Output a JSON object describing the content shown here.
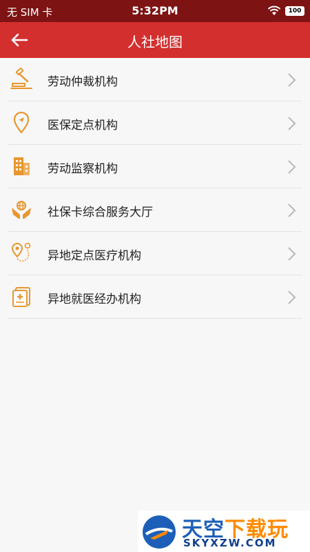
{
  "status_bar": {
    "carrier": "无 SIM 卡",
    "time": "5:32PM",
    "battery": "100"
  },
  "header": {
    "title": "人社地图"
  },
  "items": [
    {
      "label": "劳动仲裁机构",
      "icon": "gavel-icon"
    },
    {
      "label": "医保定点机构",
      "icon": "location-pin-icon"
    },
    {
      "label": "劳动监察机构",
      "icon": "building-icon"
    },
    {
      "label": "社保卡综合服务大厅",
      "icon": "hands-globe-icon"
    },
    {
      "label": "异地定点医疗机构",
      "icon": "route-pin-icon"
    },
    {
      "label": "异地就医经办机构",
      "icon": "medical-document-icon"
    }
  ],
  "colors": {
    "status_bar": "#7d1313",
    "header": "#d32f2f",
    "icon_accent": "#e8962e"
  },
  "watermark": {
    "title_blue": "天空",
    "title_orange": "下载玩",
    "url": "SKYXZW.COM"
  }
}
